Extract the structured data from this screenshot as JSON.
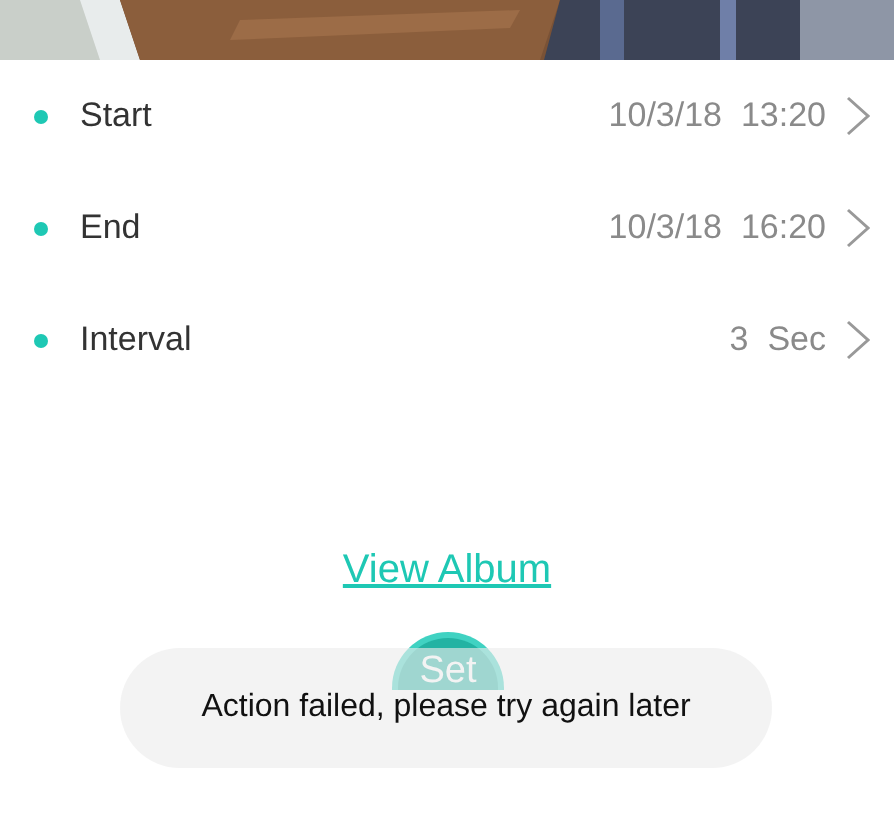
{
  "settings": [
    {
      "label": "Start",
      "value": "10/3/18  13:20"
    },
    {
      "label": "End",
      "value": "10/3/18  16:20"
    },
    {
      "label": "Interval",
      "value": "3  Sec"
    }
  ],
  "view_album_link": "View Album",
  "set_button": "Set",
  "toast": "Action failed, please try again later"
}
